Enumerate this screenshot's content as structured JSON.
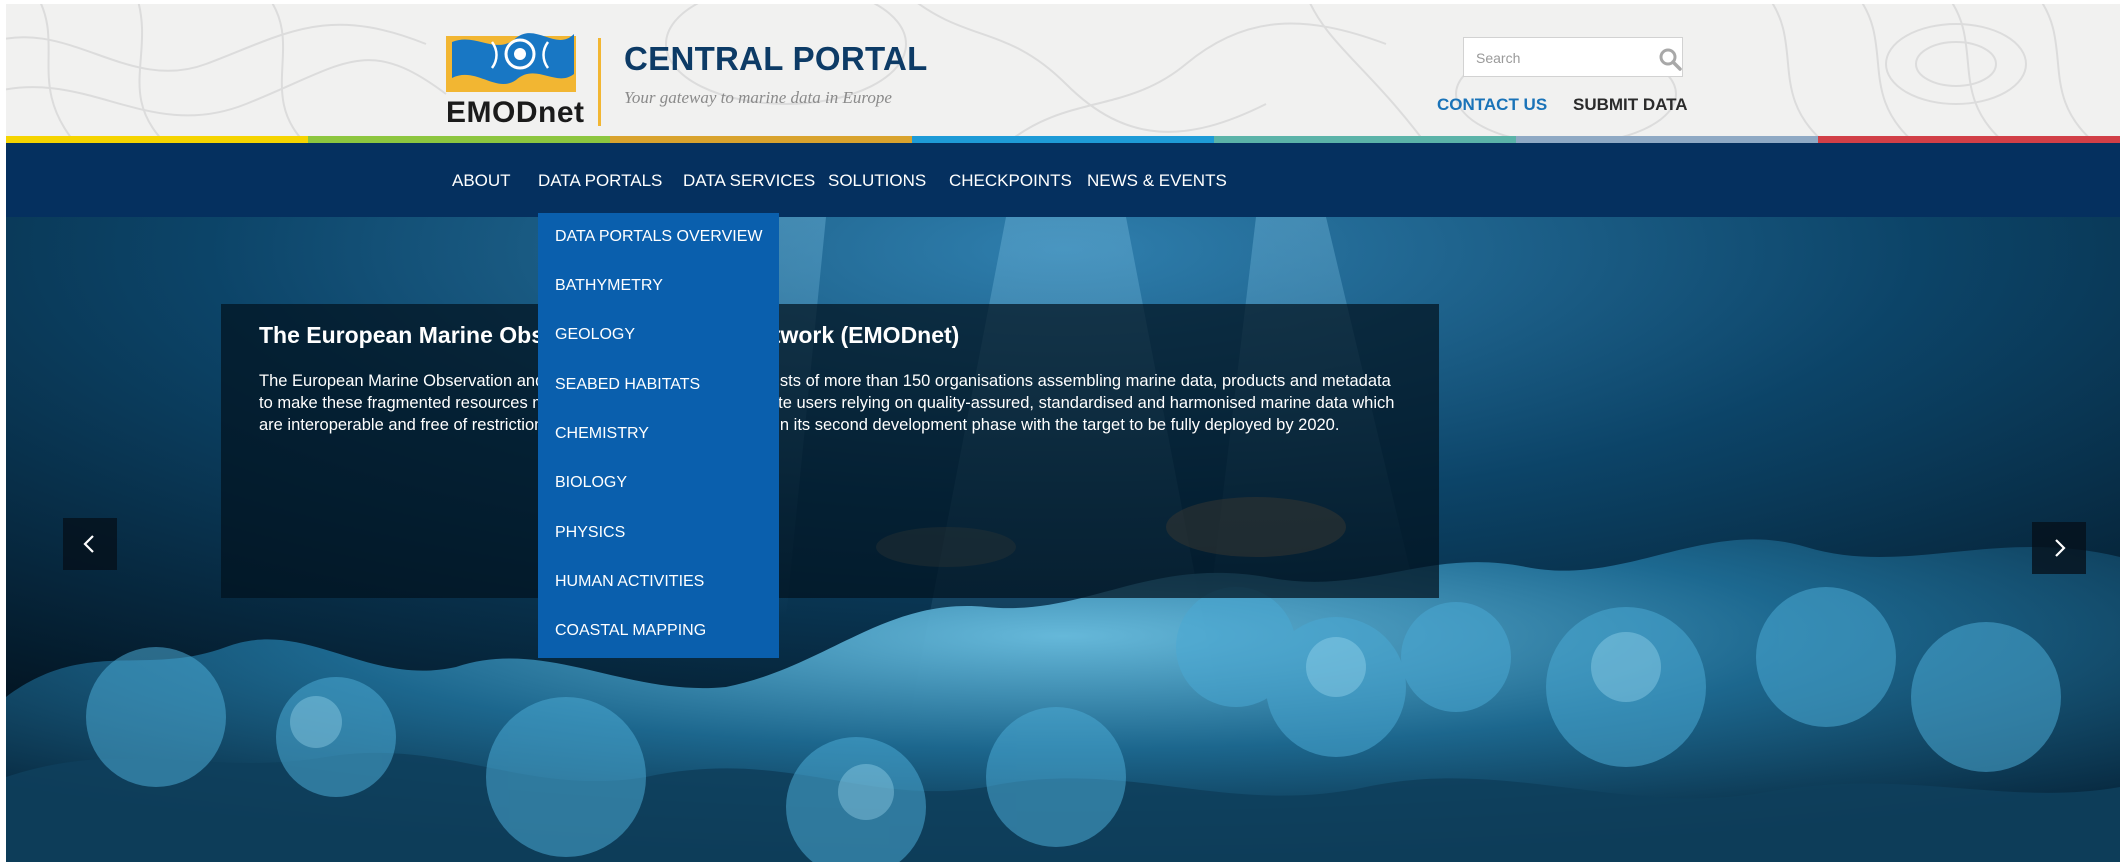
{
  "header": {
    "logo_text": "EMODnet",
    "site_title": "CENTRAL PORTAL",
    "tagline": "Your gateway to marine data in Europe",
    "search": {
      "placeholder": "Search",
      "value": ""
    },
    "links": {
      "contact": "CONTACT US",
      "submit": "SUBMIT DATA"
    }
  },
  "color_strip": [
    "#f5d400",
    "#8dc63f",
    "#d9a32e",
    "#1e9bd7",
    "#5bb3a8",
    "#8fa9c4",
    "#d13f47"
  ],
  "nav": {
    "items": [
      {
        "label": "ABOUT"
      },
      {
        "label": "DATA PORTALS"
      },
      {
        "label": "DATA SERVICES"
      },
      {
        "label": "SOLUTIONS"
      },
      {
        "label": "CHECKPOINTS"
      },
      {
        "label": "NEWS & EVENTS"
      }
    ]
  },
  "dropdown": {
    "parent": "DATA PORTALS",
    "items": [
      {
        "label": "DATA PORTALS OVERVIEW"
      },
      {
        "label": "BATHYMETRY"
      },
      {
        "label": "GEOLOGY"
      },
      {
        "label": "SEABED HABITATS"
      },
      {
        "label": "CHEMISTRY"
      },
      {
        "label": "BIOLOGY"
      },
      {
        "label": "PHYSICS"
      },
      {
        "label": "HUMAN ACTIVITIES"
      },
      {
        "label": "COASTAL MAPPING"
      }
    ]
  },
  "hero": {
    "caption_title": "The European Marine Observation and Data Network (EMODnet)",
    "caption_body": "The European Marine Observation and Data Network (EMODnet) consists of more than 150 organisations assembling marine data, products and metadata to make these fragmented resources more available to public and private users relying on quality-assured, standardised and harmonised marine data which are interoperable and free of restrictions on use. EMODnet is currently in its second development phase with the target to be fully deployed by 2020.",
    "prev_icon": "chevron-left-icon",
    "next_icon": "chevron-right-icon"
  },
  "colors": {
    "navbar": "#05305f",
    "dropdown": "#0a5fad",
    "accent_link": "#1a73b8",
    "logo_yellow": "#f2b632",
    "logo_blue": "#1877c4"
  }
}
